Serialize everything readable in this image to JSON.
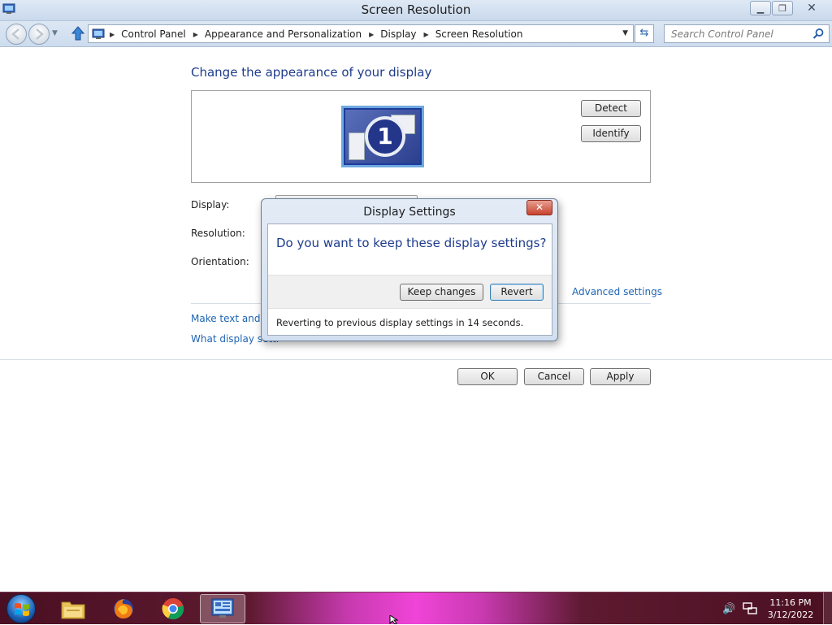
{
  "window": {
    "title": "Screen Resolution",
    "minimize_icon": "minimize-icon",
    "maximize_icon": "restore-icon",
    "close_icon": "close-icon"
  },
  "address_bar": {
    "crumbs": [
      "Control Panel",
      "Appearance and Personalization",
      "Display",
      "Screen Resolution"
    ],
    "search_placeholder": "Search Control Panel"
  },
  "main": {
    "heading": "Change the appearance of your display",
    "monitor_number": "1",
    "detect_label": "Detect",
    "identify_label": "Identify",
    "display_label": "Display:",
    "resolution_label": "Resolution:",
    "orientation_label": "Orientation:",
    "advanced_link": "Advanced settings",
    "make_text_link": "Make text and o",
    "what_display_link": "What display setti",
    "ok_label": "OK",
    "cancel_label": "Cancel",
    "apply_label": "Apply"
  },
  "dialog": {
    "title": "Display Settings",
    "close_label": "✕",
    "question": "Do you want to keep these display settings?",
    "keep_label": "Keep changes",
    "revert_label": "Revert",
    "status": "Reverting to previous display settings in 14 seconds."
  },
  "taskbar": {
    "apps": [
      "file-explorer-icon",
      "firefox-icon",
      "chrome-icon",
      "control-panel-icon"
    ],
    "active_app": "control-panel-icon",
    "time": "11:16 PM",
    "date": "3/12/2022"
  },
  "colors": {
    "heading": "#1e3c8c",
    "link": "#1e64b4",
    "taskbar_accent": "#f044d8"
  }
}
